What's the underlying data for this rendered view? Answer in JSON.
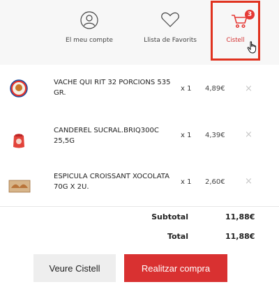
{
  "header": {
    "account_label": "El meu compte",
    "favorites_label": "Llista de Favorits",
    "cart_label": "Cistell",
    "cart_count": "3"
  },
  "cart": {
    "items": [
      {
        "name": "VACHE QUI RIT 32 PORCIONS 535 GR.",
        "qty": "x 1",
        "price": "4,89€",
        "remove": "×"
      },
      {
        "name": "CANDEREL SUCRAL.BRIQ300C 25,5G",
        "qty": "x 1",
        "price": "4,39€",
        "remove": "×"
      },
      {
        "name": "ESPICULA CROISSANT XOCOLATA 70G X 2U.",
        "qty": "x 1",
        "price": "2,60€",
        "remove": "×"
      }
    ],
    "subtotal_label": "Subtotal",
    "subtotal_value": "11,88€",
    "total_label": "Total",
    "total_value": "11,88€"
  },
  "actions": {
    "view_cart_label": "Veure Cistell",
    "checkout_label": "Realitzar compra"
  }
}
